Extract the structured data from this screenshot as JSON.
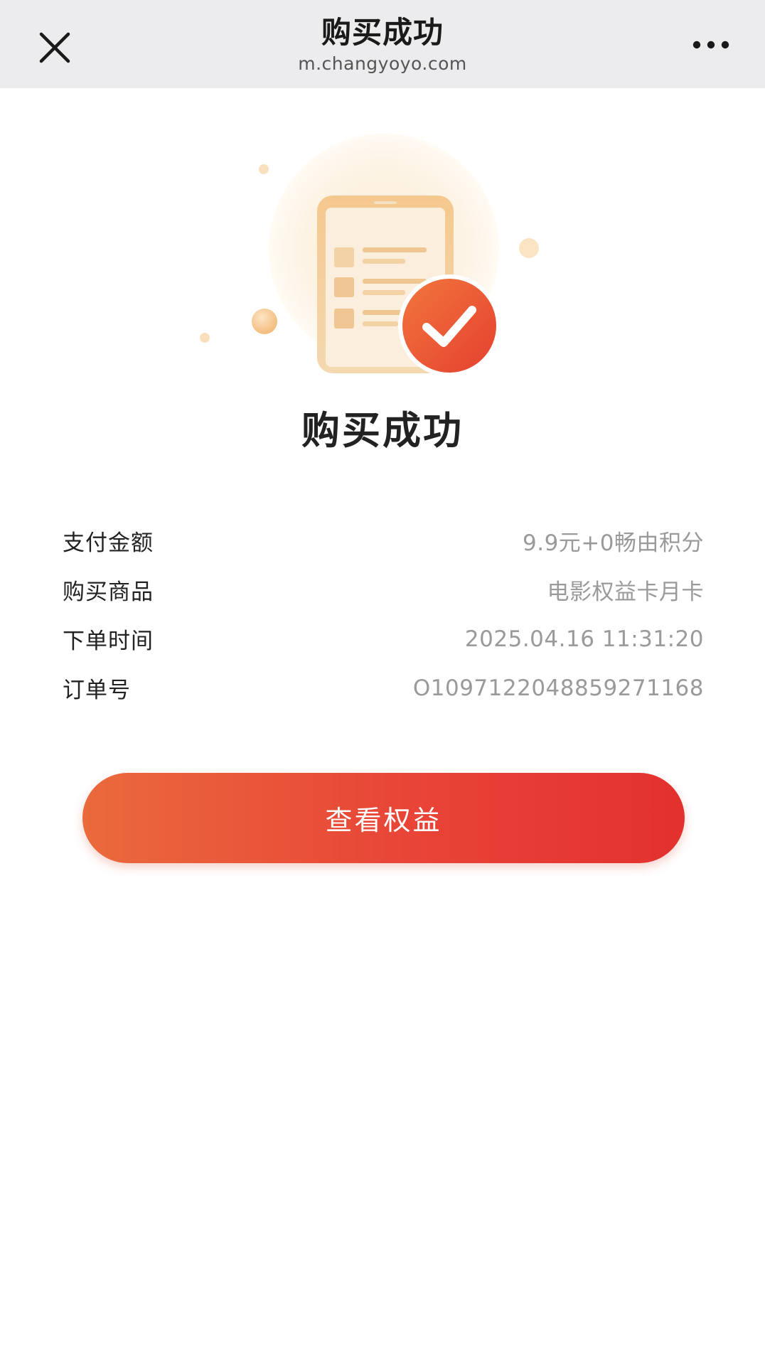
{
  "nav": {
    "title": "购买成功",
    "url": "m.changyoyo.com",
    "close_icon": "close-icon",
    "more_icon": "more-icon"
  },
  "illustration": {
    "icon": "phone-success-illustration",
    "accent": "#e8502f"
  },
  "result": {
    "title": "购买成功"
  },
  "order_info": [
    {
      "label": "支付金额",
      "value": "9.9元+0畅由积分"
    },
    {
      "label": "购买商品",
      "value": "电影权益卡月卡"
    },
    {
      "label": "下单时间",
      "value": "2025.04.16 11:31:20"
    },
    {
      "label": "订单号",
      "value": "O109712204885927116​8"
    }
  ],
  "action": {
    "label": "查看权益"
  },
  "colors": {
    "topbar_bg": "#ececee",
    "button_start": "#ea6a3c",
    "button_end": "#e3312e",
    "label_text": "#222222",
    "value_text": "#9a9a9a"
  }
}
